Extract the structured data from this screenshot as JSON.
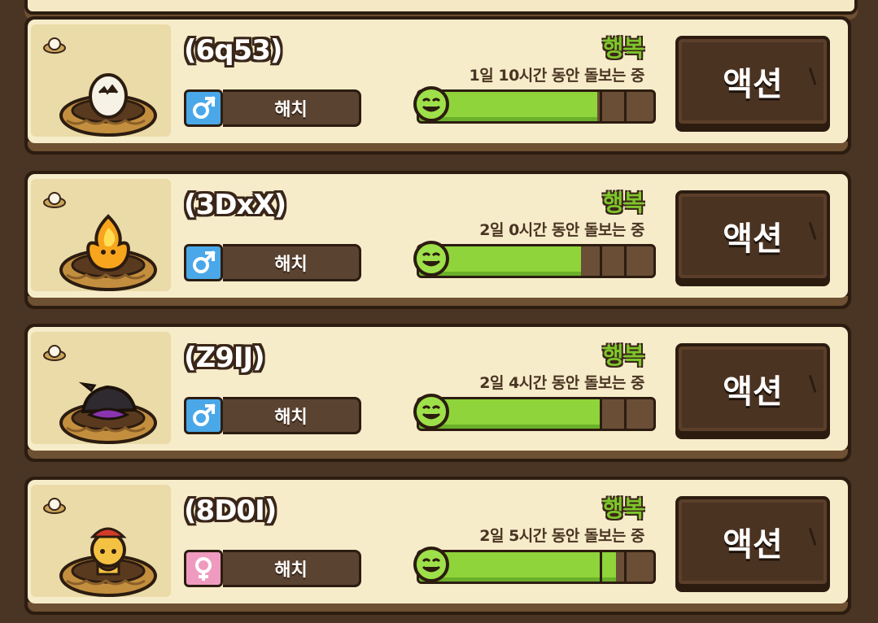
{
  "pets": [
    {
      "name": "(6q53)",
      "gender": "male",
      "gender_symbol": "♂",
      "stage": "해치",
      "mood": "행복",
      "duration": "1일 10시간 동안 돌보는 중",
      "happiness": 0.76,
      "creature": "cracked-egg",
      "action": "액션"
    },
    {
      "name": "(3DxX)",
      "gender": "male",
      "gender_symbol": "♂",
      "stage": "해치",
      "mood": "행복",
      "duration": "2일 0시간 동안 돌보는 중",
      "happiness": 0.69,
      "creature": "fire-creature",
      "action": "액션"
    },
    {
      "name": "(Z9IJ)",
      "gender": "male",
      "gender_symbol": "♂",
      "stage": "해치",
      "mood": "행복",
      "duration": "2일 4시간 동안 돌보는 중",
      "happiness": 0.78,
      "creature": "dark-creature",
      "action": "액션"
    },
    {
      "name": "(8D0I)",
      "gender": "female",
      "gender_symbol": "♀",
      "stage": "해치",
      "mood": "행복",
      "duration": "2일 5시간 동안 돌보는 중",
      "happiness": 0.84,
      "creature": "fox-creature",
      "action": "액션"
    }
  ],
  "colors": {
    "background": "#4a3423",
    "card": "#f6ecca",
    "mood_green": "#7ec62b",
    "bar_fill": "#8fd43a",
    "male_blue": "#4aa8e8",
    "female_pink": "#ef9bbf",
    "button_brown": "#4b3322"
  }
}
